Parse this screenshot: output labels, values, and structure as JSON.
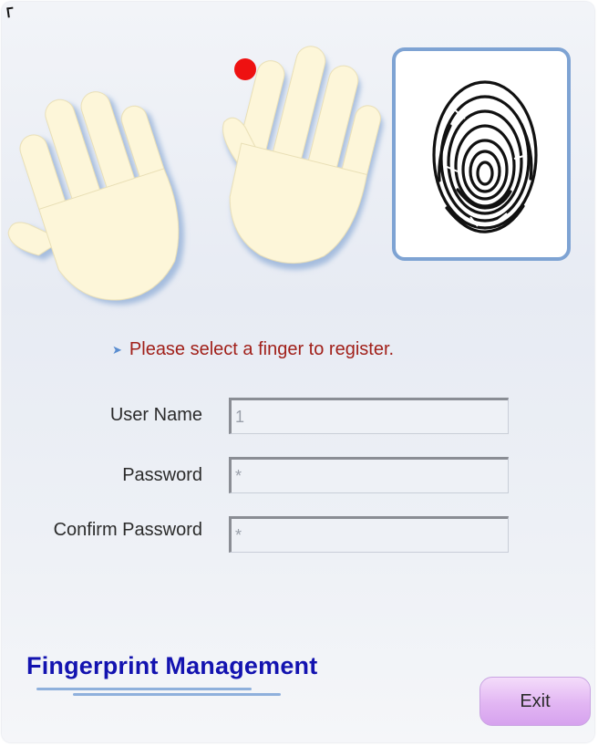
{
  "window": {
    "prompt": "Please select a finger to register.",
    "selected_finger_color": "#ee1111"
  },
  "form": {
    "user_name_label": "User Name",
    "user_name_value": "1",
    "password_label": "Password",
    "password_value": "*",
    "confirm_password_label": "Confirm Password",
    "confirm_password_value": "*"
  },
  "footer": {
    "brand": "Fingerprint Management",
    "exit_label": "Exit"
  },
  "colors": {
    "prompt_text": "#a1201a",
    "brand_text": "#1313b0",
    "frame_border": "#7ea3d3",
    "exit_button": "#e2b6f3"
  },
  "icons": [
    "left-hand-icon",
    "right-hand-icon",
    "selected-finger-dot-icon",
    "fingerprint-icon",
    "prompt-arrow-icon"
  ]
}
